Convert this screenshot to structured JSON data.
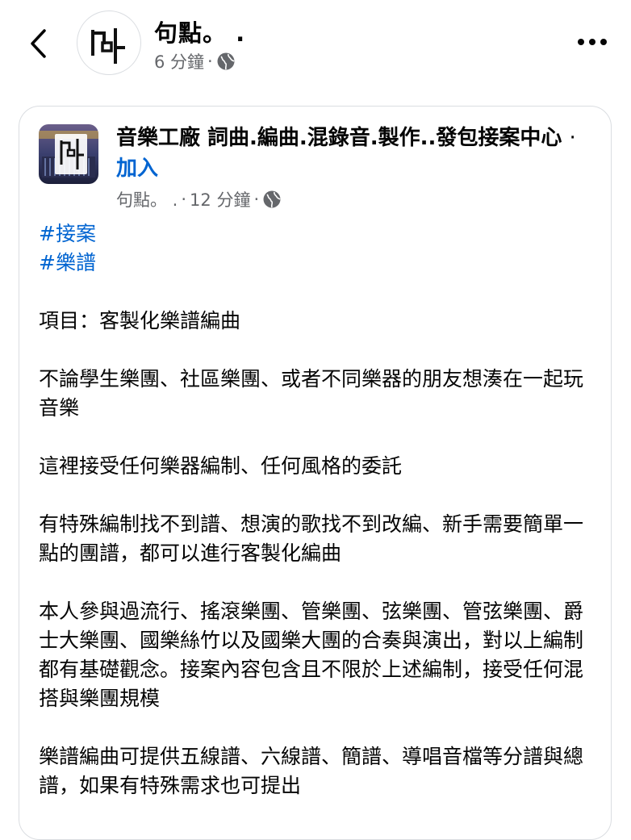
{
  "header": {
    "back_icon": "chevron-left-icon",
    "page_name": "句點。 .",
    "time": "6 分鐘",
    "dot": "·",
    "privacy_icon": "globe-icon",
    "more_icon": "more-horizontal-icon"
  },
  "shared_post": {
    "group_name": "音樂工廠 詞曲.編曲.混錄音.製作..發包接案中心",
    "separator": "·",
    "join_label": "加入",
    "author": "句點。 .",
    "dot1": "·",
    "time": "12 分鐘",
    "dot2": "·",
    "privacy_icon": "globe-icon",
    "hashtags": [
      "#接案",
      "#樂譜"
    ],
    "paragraphs": [
      "項目：客製化樂譜編曲",
      "不論學生樂團、社區樂團、或者不同樂器的朋友想湊在一起玩音樂",
      "這裡接受任何樂器編制、任何風格的委託",
      "有特殊編制找不到譜、想演的歌找不到改編、新手需要簡單一點的團譜，都可以進行客製化編曲",
      "本人參與過流行、搖滾樂團、管樂團、弦樂團、管弦樂團、爵士大樂團、國樂絲竹以及國樂大團的合奏與演出，對以上編制都有基礎觀念。接案內容包含且不限於上述編制，接受任何混搭與樂團規模",
      "樂譜編曲可提供五線譜、六線譜、簡譜、導唱音檔等分譜與總譜，如果有特殊需求也可提出"
    ]
  },
  "colors": {
    "link": "#0064d1",
    "secondary_text": "#65676b",
    "border": "#dadde1"
  }
}
